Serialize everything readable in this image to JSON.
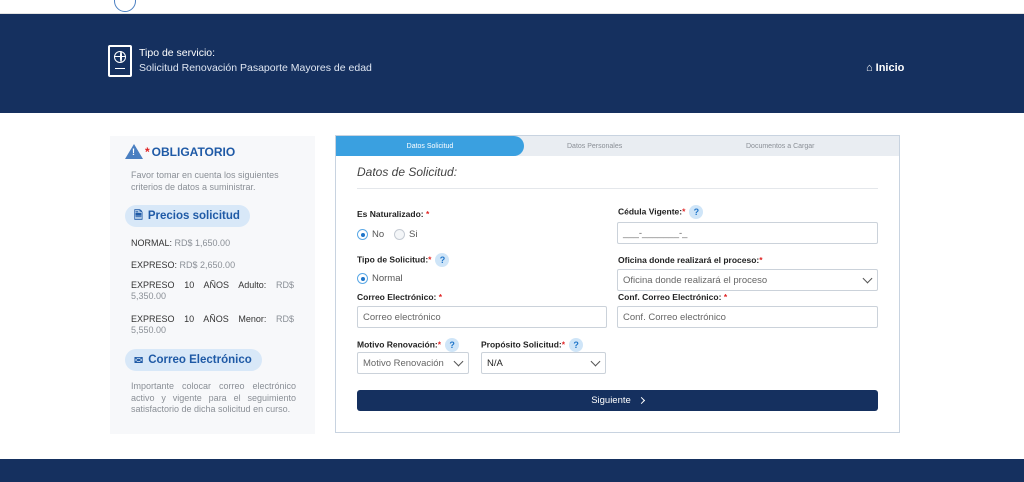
{
  "header": {
    "service_label": "Tipo de servicio:",
    "service_value": "Solicitud Renovación Pasaporte Mayores de edad",
    "home_label": "Inicio"
  },
  "info": {
    "required_star": "*",
    "required_title": "OBLIGATORIO",
    "required_note": "Favor tomar en cuenta los siguientes criterios de datos a suministrar.",
    "prices_title": "Precios solicitud",
    "prices": [
      {
        "label": "NORMAL:",
        "value": "RD$ 1,650.00"
      },
      {
        "label": "EXPRESO:",
        "value": "RD$ 2,650.00"
      },
      {
        "label": "EXPRESO 10 AÑOS Adulto:",
        "value": "RD$ 5,350.00"
      },
      {
        "label": "EXPRESO 10 AÑOS Menor:",
        "value": "RD$ 5,550.00"
      }
    ],
    "email_title": "Correo Electrónico",
    "email_note": "Importante colocar correo electrónico activo y vigente para el seguimiento satisfactorio de dicha solicitud en curso."
  },
  "tabs": [
    {
      "label": "Datos Solicitud",
      "active": true
    },
    {
      "label": "Datos Personales",
      "active": false
    },
    {
      "label": "Documentos a Cargar",
      "active": false
    }
  ],
  "form": {
    "title": "Datos de Solicitud:",
    "req": "*",
    "help": "?",
    "naturalized_label": "Es Naturalizado:",
    "naturalized_options": [
      "No",
      "Si"
    ],
    "cedula_label": "Cédula Vigente:",
    "cedula_placeholder": "___-_______-_",
    "type_label": "Tipo de Solicitud:",
    "type_option": "Normal",
    "office_label": "Oficina donde realizará el proceso:",
    "office_placeholder": "Oficina donde realizará el proceso",
    "email_label": "Correo Electrónico:",
    "email_placeholder": "Correo electrónico",
    "confirm_email_label": "Conf. Correo Electrónico:",
    "confirm_email_placeholder": "Conf. Correo electrónico",
    "reason_label": "Motivo Renovación:",
    "reason_value": "Motivo Renovación",
    "purpose_label": "Propósito Solicitud:",
    "purpose_value": "N/A",
    "next_button": "Siguiente"
  },
  "colors": {
    "navy": "#15305f",
    "accent": "#3aa0e0",
    "link_blue": "#1f5aa6",
    "required_red": "#e02424"
  },
  "icons": [
    "passport-icon",
    "home-icon",
    "warning-icon",
    "document-icon",
    "envelope-icon",
    "help-icon",
    "chevron-down-icon",
    "chevron-right-icon"
  ]
}
